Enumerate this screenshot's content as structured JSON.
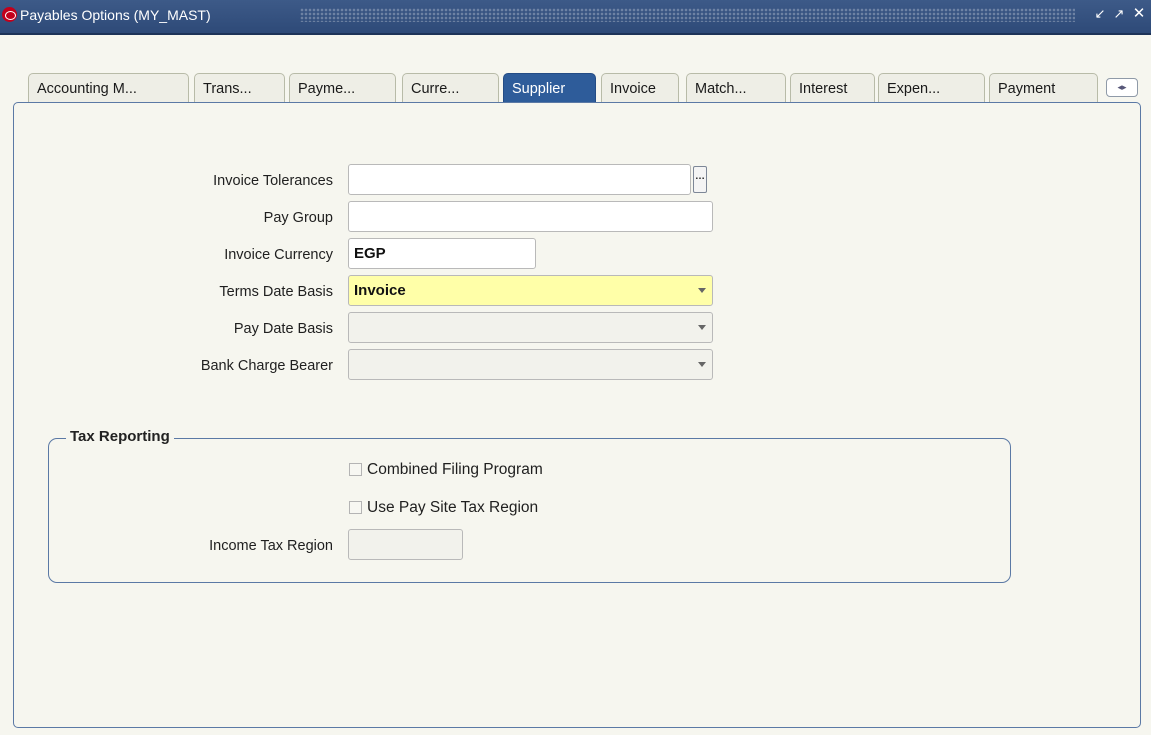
{
  "window": {
    "title": "Payables Options (MY_MAST)",
    "controls": {
      "minimize": "minimize-icon",
      "maximize": "maximize-icon",
      "close": "close-icon"
    }
  },
  "tabs": [
    {
      "label": "Accounting M...",
      "active": false
    },
    {
      "label": "Trans...",
      "active": false
    },
    {
      "label": "Payme...",
      "active": false
    },
    {
      "label": "Curre...",
      "active": false
    },
    {
      "label": "Supplier",
      "active": true
    },
    {
      "label": "Invoice",
      "active": false
    },
    {
      "label": "Match...",
      "active": false
    },
    {
      "label": "Interest",
      "active": false
    },
    {
      "label": "Expen...",
      "active": false
    },
    {
      "label": "Payment",
      "active": false
    }
  ],
  "form": {
    "invoice_tolerances": {
      "label": "Invoice Tolerances",
      "value": ""
    },
    "pay_group": {
      "label": "Pay Group",
      "value": ""
    },
    "invoice_currency": {
      "label": "Invoice Currency",
      "value": "EGP"
    },
    "terms_date_basis": {
      "label": "Terms Date Basis",
      "value": "Invoice"
    },
    "pay_date_basis": {
      "label": "Pay Date Basis",
      "value": ""
    },
    "bank_charge_bearer": {
      "label": "Bank Charge Bearer",
      "value": ""
    }
  },
  "tax_reporting": {
    "title": "Tax Reporting",
    "combined_filing": {
      "label": "Combined Filing Program",
      "checked": false
    },
    "use_pay_site": {
      "label": "Use Pay Site Tax Region",
      "checked": false
    },
    "income_tax_region": {
      "label": "Income Tax Region",
      "value": ""
    }
  },
  "colors": {
    "active_tab": "#2e5c9a",
    "title_bar": "#2e4a78",
    "required_field": "#ffffa8"
  }
}
